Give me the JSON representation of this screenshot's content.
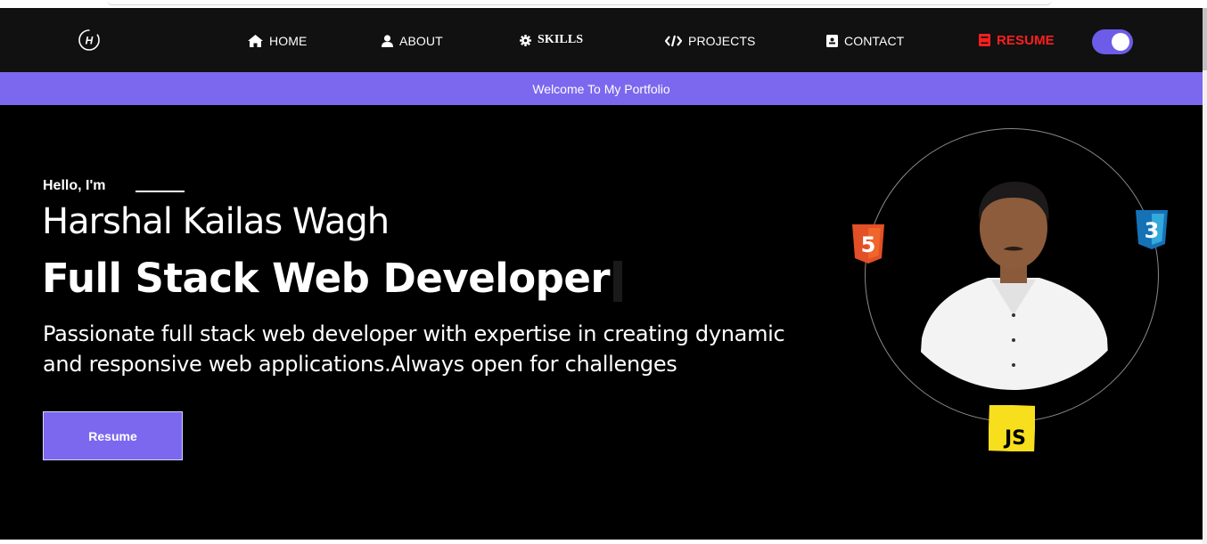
{
  "nav": {
    "items": [
      {
        "label": "HOME",
        "icon": "home-icon"
      },
      {
        "label": "ABOUT",
        "icon": "user-icon"
      },
      {
        "label": "SKILLS",
        "icon": "gear-icon"
      },
      {
        "label": "PROJECTS",
        "icon": "code-icon"
      },
      {
        "label": "CONTACT",
        "icon": "contact-card-icon"
      },
      {
        "label": "RESUME",
        "icon": "book-icon"
      }
    ],
    "logo_letter": "H",
    "resume_color": "#ff1e1e",
    "toggle_state": "on"
  },
  "banner": {
    "text": "Welcome To My Portfolio"
  },
  "hero": {
    "greeting": "Hello, I'm",
    "name": "Harshal Kailas Wagh",
    "role": "Full Stack Web Developer",
    "description": "Passionate full stack web developer with expertise in creating dynamic and responsive web applications.Always open for challenges",
    "button_label": "Resume"
  },
  "badges": {
    "html": "5",
    "css": "3",
    "js": "JS"
  },
  "colors": {
    "accent": "#7b68ee",
    "nav_bg": "#111111",
    "hero_bg": "#000000"
  }
}
